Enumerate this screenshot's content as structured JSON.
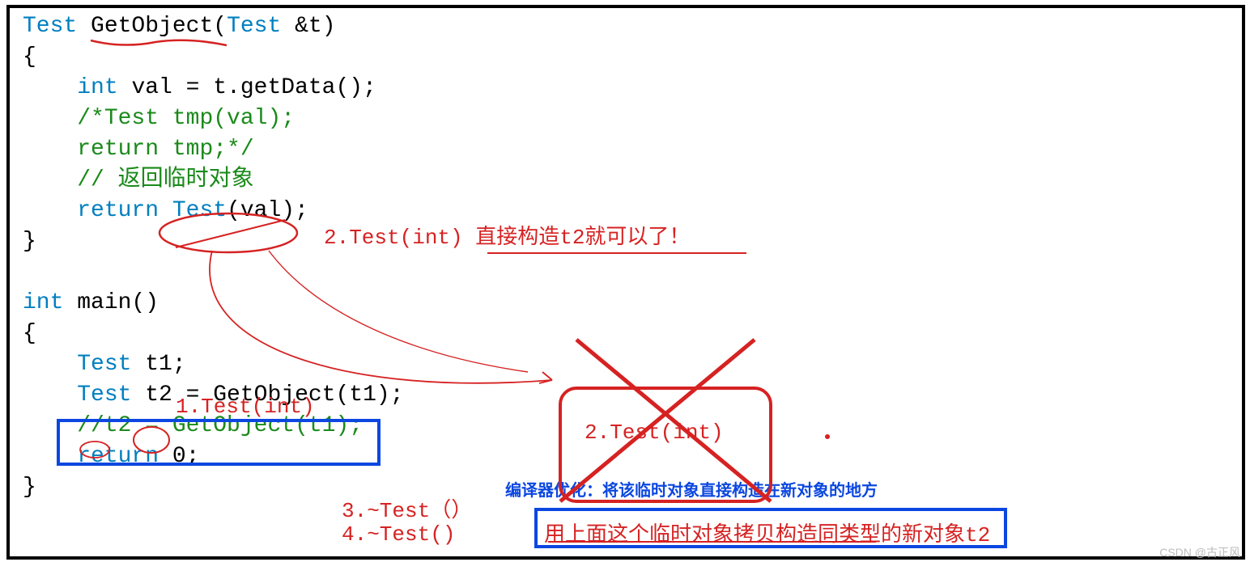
{
  "code": {
    "l1a": "Test",
    "l1b": " GetObject(",
    "l1c": "Test",
    "l1d": " &t)",
    "l2": "{",
    "l3a": "    ",
    "l3b": "int",
    "l3c": " val = t.getData();",
    "l4a": "    ",
    "l4b": "/*Test tmp(val);",
    "l5a": "    ",
    "l5b": "return tmp;*/",
    "l6a": "    ",
    "l6b": "// 返回临时对象",
    "l7a": "    ",
    "l7b": "return",
    "l7c": " ",
    "l7d": "Test",
    "l7e": "(val);",
    "l8": "}",
    "l9": "",
    "l10a": "int",
    "l10b": " main()",
    "l11": "{",
    "l12a": "    ",
    "l12b": "Test",
    "l12c": " t1;",
    "l13a": "    ",
    "l13b": "Test",
    "l13c": " t2 = GetObject(t1);",
    "l14a": "    ",
    "l14b": "//t2 = GetObject(t1);",
    "l15a": "    ",
    "l15b": "return",
    "l15c": " 0;",
    "l16": "}"
  },
  "annotations": {
    "a1": "1.Test(int)",
    "a2": "2.Test(int) 直接构造t2就可以了！",
    "a2box": "2.Test(int)",
    "a3": "3.~Test（）",
    "a4": "4.~Test()",
    "blue": "编译器优化：将该临时对象直接构造在新对象的地方",
    "bottom": "用上面这个临时对象拷贝构造同类型的新对象t2"
  },
  "watermark": "CSDN @古正风"
}
